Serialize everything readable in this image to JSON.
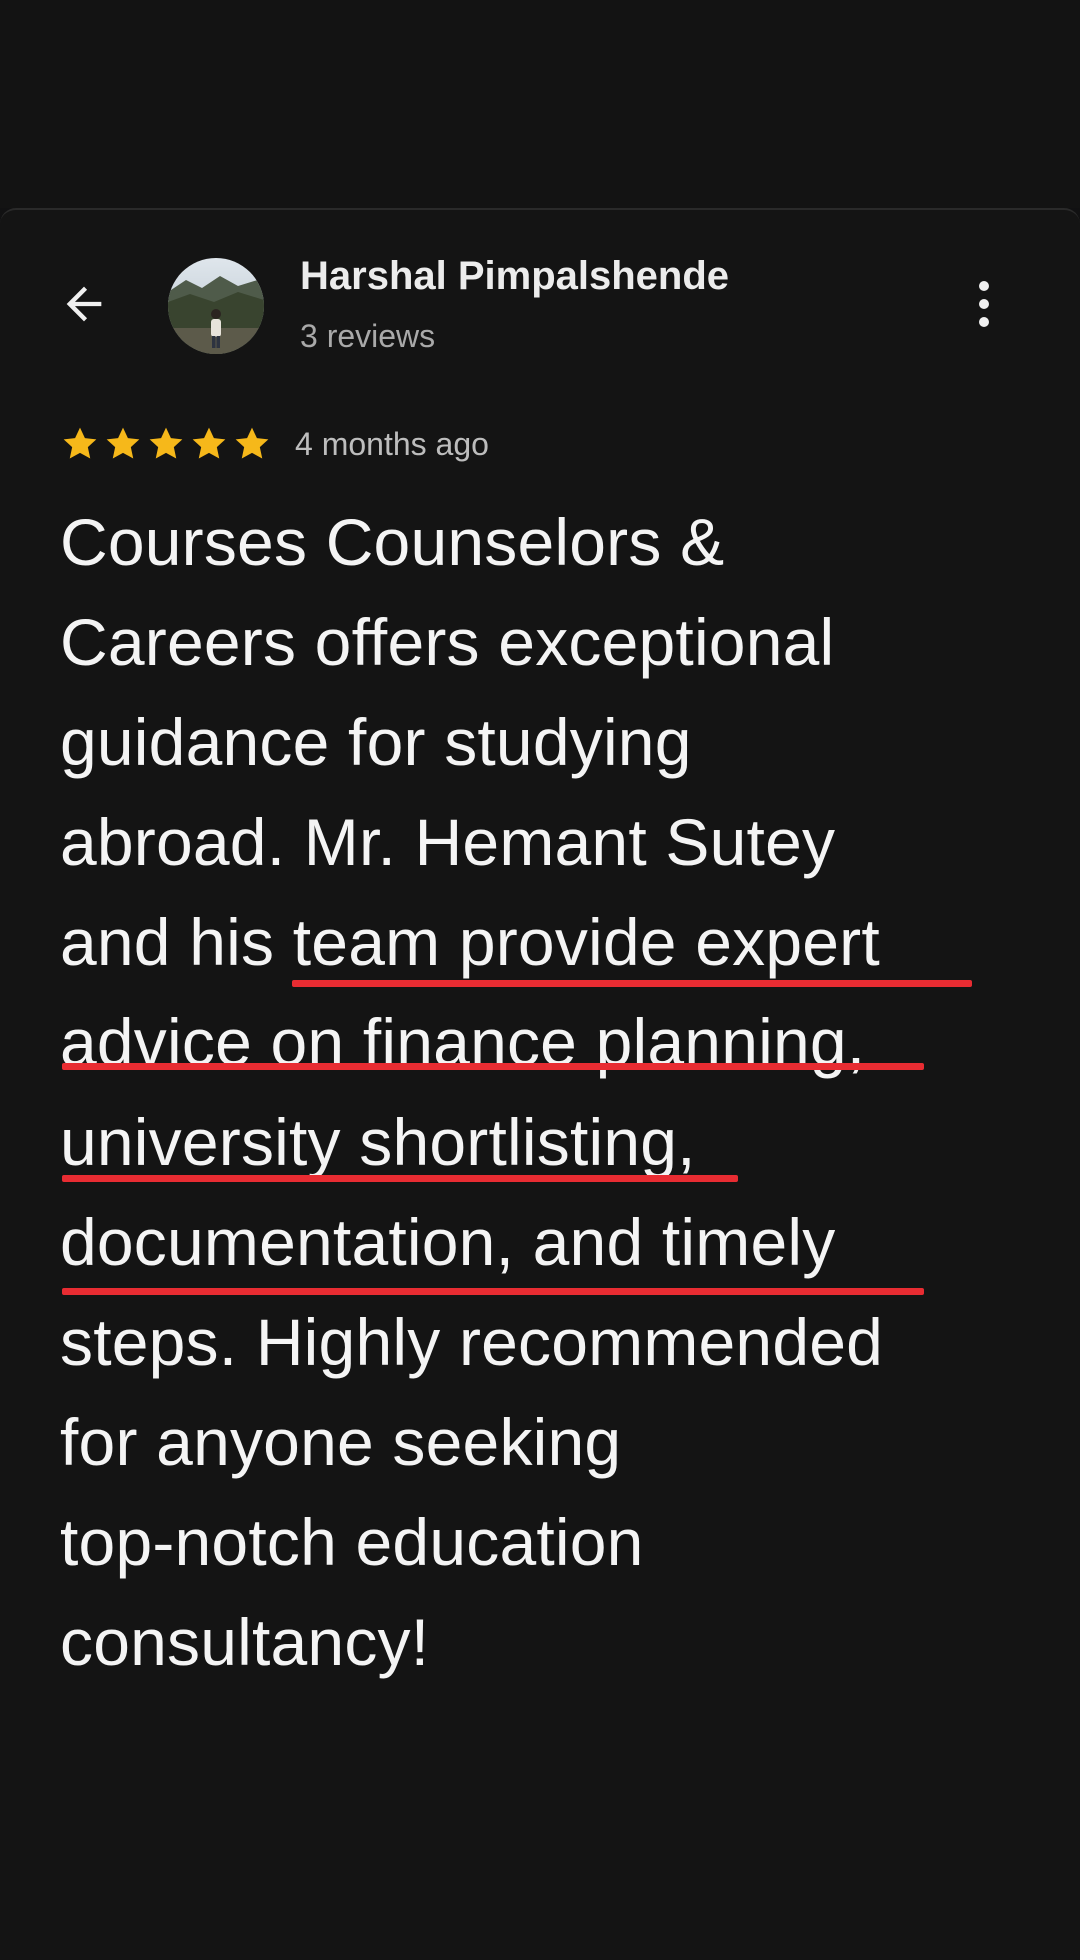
{
  "reviewer": {
    "name": "Harshal Pimpalshende",
    "review_count": "3 reviews"
  },
  "review": {
    "rating": 5,
    "max_rating": 5,
    "date": "4 months ago",
    "lines": [
      "Courses Counselors &",
      "Careers offers exceptional",
      "guidance for studying",
      "abroad. Mr. Hemant Sutey",
      "and his team provide expert",
      "advice on finance planning,",
      "university shortlisting,",
      "documentation, and timely",
      "steps. Highly recommended",
      "for anyone seeking",
      "top-notch education",
      "consultancy!"
    ]
  },
  "colors": {
    "background": "#111112",
    "star": "#f6b81a",
    "annotation_underline": "#e82c32"
  },
  "icons": {
    "back": "arrow-left-icon",
    "more": "more-vertical-icon",
    "star": "star-icon"
  }
}
